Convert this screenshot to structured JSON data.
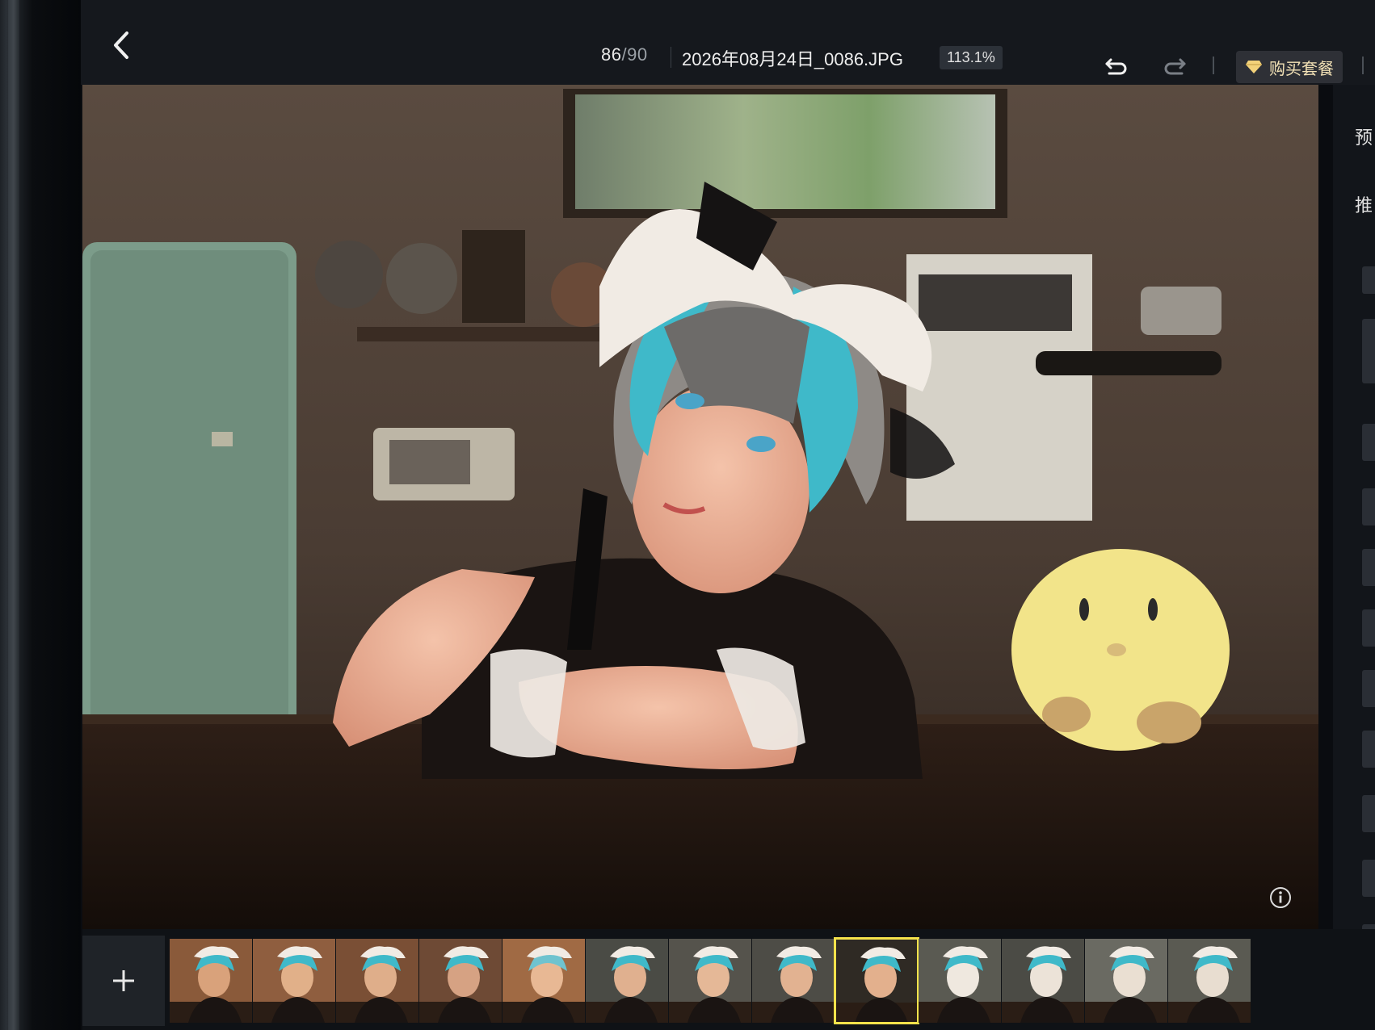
{
  "header": {
    "back_icon": "chevron-left-icon",
    "counter_current": "86",
    "counter_total": "/90",
    "filename": "2026年08月24日_0086.JPG",
    "zoom": "113.1%",
    "undo_icon": "undo-icon",
    "redo_icon": "redo-icon",
    "buy_icon": "diamond-icon",
    "buy_label": "购买套餐"
  },
  "right_panel": {
    "label_preview": "预",
    "label_recommend": "推"
  },
  "viewer": {
    "info_icon": "info-icon"
  },
  "strip": {
    "add_icon": "plus-icon",
    "thumb_count": 13,
    "selected_index": 8
  },
  "colors": {
    "toolbar_bg": "#15181d",
    "accent_gold": "#f3e2b6",
    "selected_border": "#f4e24b"
  }
}
